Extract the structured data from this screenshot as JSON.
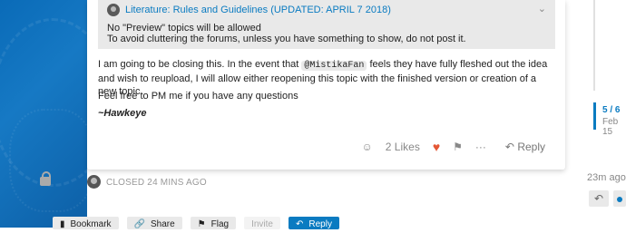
{
  "quote": {
    "title": "Literature: Rules and Guidelines (UPDATED: APRIL 7 2018)",
    "lines": [
      "No \"Preview\" topics will be allowed",
      "To avoid cluttering the forums, unless you have something to show, do not post it."
    ]
  },
  "post": {
    "para1_before": "I am going to be closing this. In the event that",
    "mention": "@MistikaFan",
    "para1_after": "feels they have fully fleshed out the idea and wish to reupload, I will allow either reopening this topic with the finished version or creation of a new topic.",
    "para2": "Feel free to PM me if you have any questions",
    "signature": "~Hawkeye"
  },
  "actions": {
    "likes": "2 Likes",
    "reply": "Reply"
  },
  "closed": {
    "text": "CLOSED 24 MINS AGO",
    "time": "23m ago"
  },
  "timeline": {
    "count": "5 / 6",
    "date": "Feb 15"
  },
  "bottom_bar": {
    "bookmark": "Bookmark",
    "share": "Share",
    "flag": "Flag",
    "invite": "Invite",
    "reply": "Reply"
  },
  "icons": [
    "avatar",
    "chevron-down-icon",
    "smile-icon",
    "heart-icon",
    "flag-icon",
    "more-icon",
    "reply-icon",
    "lock-icon",
    "bookmark-icon",
    "share-icon"
  ],
  "colors": {
    "accent": "#0a7bc1",
    "heart": "#e45735"
  }
}
